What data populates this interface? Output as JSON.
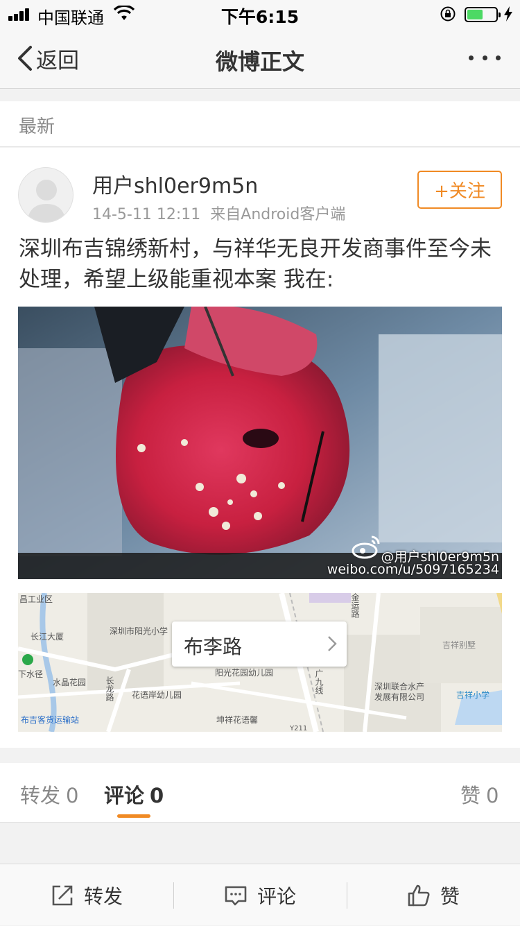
{
  "status_bar": {
    "carrier": "中国联通",
    "time": "下午6:15",
    "battery_level": 0.55
  },
  "nav": {
    "back_label": "返回",
    "title": "微博正文"
  },
  "latest_label": "最新",
  "post": {
    "username": "用户shl0er9m5n",
    "timestamp": "14-5-11 12:11",
    "source": "来自Android客户端",
    "follow_label": "+关注",
    "text": "深圳布吉锦绣新村，与祥华无良开发商事件至今未处理，希望上级能重视本案 我在:",
    "photo_watermark_user": "@用户shl0er9m5n",
    "photo_watermark_url": "weibo.com/u/5097165234"
  },
  "map": {
    "location_label": "布李路",
    "labels": [
      "昌工业区",
      "长江大厦",
      "深圳市阳光小学",
      "下水径",
      "水晶花园",
      "阳光花园幼儿园",
      "花语岸幼儿园",
      "坤祥花语馨",
      "布吉客货运输站",
      "长龙路",
      "金运路",
      "广九线",
      "吉祥别墅",
      "深圳联合水产发展有限公司",
      "吉祥小学",
      "Y211"
    ]
  },
  "tabs": [
    {
      "label": "转发",
      "count": "0"
    },
    {
      "label": "评论",
      "count": "0"
    },
    {
      "label": "赞",
      "count": "0"
    }
  ],
  "toolbar": {
    "repost_label": "转发",
    "comment_label": "评论",
    "like_label": "赞"
  },
  "icons": [
    "signal-icon",
    "wifi-icon",
    "orientation-lock-icon",
    "battery-icon",
    "charging-icon",
    "back-chevron-icon",
    "more-icon",
    "avatar-icon",
    "weibo-logo-icon",
    "chevron-right-icon",
    "share-icon",
    "comment-icon",
    "thumbs-up-icon"
  ],
  "colors": {
    "accent": "#f08a24",
    "battery": "#4cd964"
  }
}
